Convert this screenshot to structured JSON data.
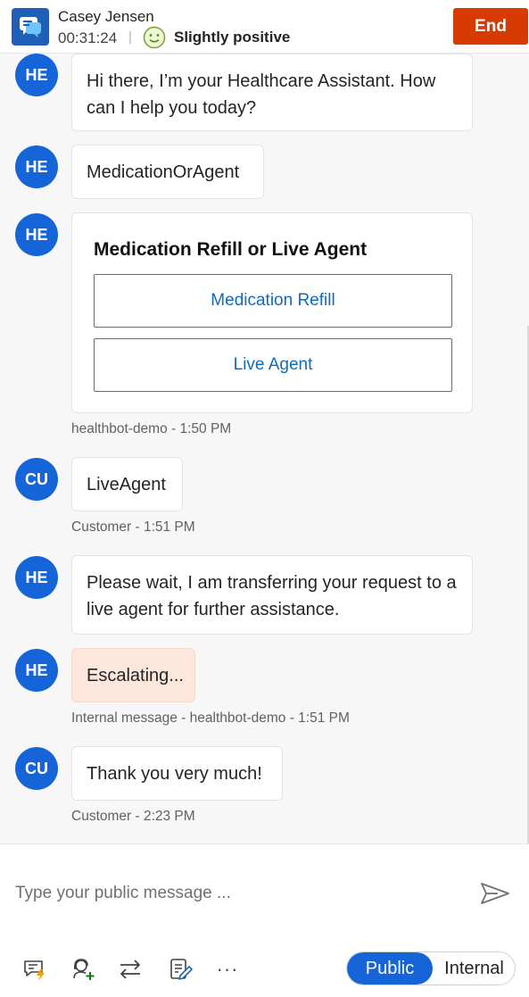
{
  "header": {
    "customer_name": "Casey Jensen",
    "timer": "00:31:24",
    "separator": "|",
    "sentiment": "Slightly positive",
    "end_label": "End",
    "end_color": "#d83b01"
  },
  "messages": [
    {
      "avatar": "HE",
      "text": "Hi there, I’m your Healthcare Assistant. How can I help you today?"
    },
    {
      "avatar": "HE",
      "text": "MedicationOrAgent"
    },
    {
      "avatar": "HE",
      "card": {
        "title": "Medication Refill or Live Agent",
        "buttons": [
          "Medication Refill",
          "Live Agent"
        ]
      },
      "meta": "healthbot-demo - 1:50 PM"
    },
    {
      "avatar": "CU",
      "text": "LiveAgent",
      "meta": "Customer - 1:51 PM"
    },
    {
      "avatar": "HE",
      "text": "Please wait, I am transferring your request to a live agent for further assistance."
    },
    {
      "avatar": "HE",
      "text": "Escalating...",
      "meta": "Internal message - healthbot-demo - 1:51 PM"
    },
    {
      "avatar": "CU",
      "text": "Thank you very much!",
      "meta": "Customer - 2:23 PM"
    }
  ],
  "composer": {
    "placeholder": "Type your public message ...",
    "toolbar_icons": [
      "quick-replies-icon",
      "consult-icon",
      "transfer-icon",
      "notes-icon",
      "more-icon"
    ],
    "more_label": "···",
    "mode_public": "Public",
    "mode_internal": "Internal",
    "accent": "#1565d8"
  }
}
